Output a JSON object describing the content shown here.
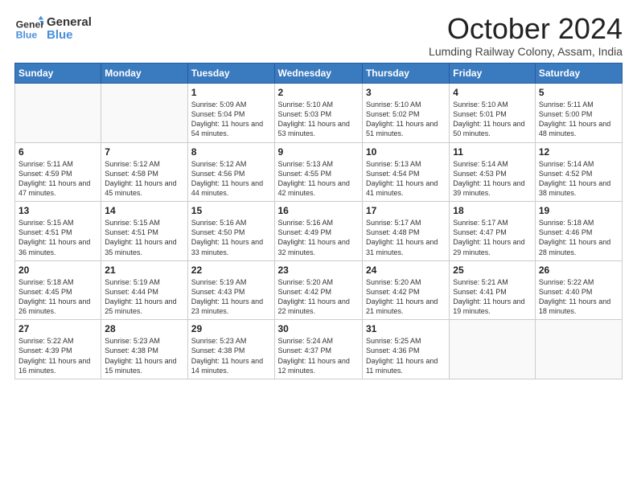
{
  "header": {
    "logo_line1": "General",
    "logo_line2": "Blue",
    "month_title": "October 2024",
    "location": "Lumding Railway Colony, Assam, India"
  },
  "days_of_week": [
    "Sunday",
    "Monday",
    "Tuesday",
    "Wednesday",
    "Thursday",
    "Friday",
    "Saturday"
  ],
  "weeks": [
    [
      {
        "day": "",
        "info": ""
      },
      {
        "day": "",
        "info": ""
      },
      {
        "day": "1",
        "info": "Sunrise: 5:09 AM\nSunset: 5:04 PM\nDaylight: 11 hours and 54 minutes."
      },
      {
        "day": "2",
        "info": "Sunrise: 5:10 AM\nSunset: 5:03 PM\nDaylight: 11 hours and 53 minutes."
      },
      {
        "day": "3",
        "info": "Sunrise: 5:10 AM\nSunset: 5:02 PM\nDaylight: 11 hours and 51 minutes."
      },
      {
        "day": "4",
        "info": "Sunrise: 5:10 AM\nSunset: 5:01 PM\nDaylight: 11 hours and 50 minutes."
      },
      {
        "day": "5",
        "info": "Sunrise: 5:11 AM\nSunset: 5:00 PM\nDaylight: 11 hours and 48 minutes."
      }
    ],
    [
      {
        "day": "6",
        "info": "Sunrise: 5:11 AM\nSunset: 4:59 PM\nDaylight: 11 hours and 47 minutes."
      },
      {
        "day": "7",
        "info": "Sunrise: 5:12 AM\nSunset: 4:58 PM\nDaylight: 11 hours and 45 minutes."
      },
      {
        "day": "8",
        "info": "Sunrise: 5:12 AM\nSunset: 4:56 PM\nDaylight: 11 hours and 44 minutes."
      },
      {
        "day": "9",
        "info": "Sunrise: 5:13 AM\nSunset: 4:55 PM\nDaylight: 11 hours and 42 minutes."
      },
      {
        "day": "10",
        "info": "Sunrise: 5:13 AM\nSunset: 4:54 PM\nDaylight: 11 hours and 41 minutes."
      },
      {
        "day": "11",
        "info": "Sunrise: 5:14 AM\nSunset: 4:53 PM\nDaylight: 11 hours and 39 minutes."
      },
      {
        "day": "12",
        "info": "Sunrise: 5:14 AM\nSunset: 4:52 PM\nDaylight: 11 hours and 38 minutes."
      }
    ],
    [
      {
        "day": "13",
        "info": "Sunrise: 5:15 AM\nSunset: 4:51 PM\nDaylight: 11 hours and 36 minutes."
      },
      {
        "day": "14",
        "info": "Sunrise: 5:15 AM\nSunset: 4:51 PM\nDaylight: 11 hours and 35 minutes."
      },
      {
        "day": "15",
        "info": "Sunrise: 5:16 AM\nSunset: 4:50 PM\nDaylight: 11 hours and 33 minutes."
      },
      {
        "day": "16",
        "info": "Sunrise: 5:16 AM\nSunset: 4:49 PM\nDaylight: 11 hours and 32 minutes."
      },
      {
        "day": "17",
        "info": "Sunrise: 5:17 AM\nSunset: 4:48 PM\nDaylight: 11 hours and 31 minutes."
      },
      {
        "day": "18",
        "info": "Sunrise: 5:17 AM\nSunset: 4:47 PM\nDaylight: 11 hours and 29 minutes."
      },
      {
        "day": "19",
        "info": "Sunrise: 5:18 AM\nSunset: 4:46 PM\nDaylight: 11 hours and 28 minutes."
      }
    ],
    [
      {
        "day": "20",
        "info": "Sunrise: 5:18 AM\nSunset: 4:45 PM\nDaylight: 11 hours and 26 minutes."
      },
      {
        "day": "21",
        "info": "Sunrise: 5:19 AM\nSunset: 4:44 PM\nDaylight: 11 hours and 25 minutes."
      },
      {
        "day": "22",
        "info": "Sunrise: 5:19 AM\nSunset: 4:43 PM\nDaylight: 11 hours and 23 minutes."
      },
      {
        "day": "23",
        "info": "Sunrise: 5:20 AM\nSunset: 4:42 PM\nDaylight: 11 hours and 22 minutes."
      },
      {
        "day": "24",
        "info": "Sunrise: 5:20 AM\nSunset: 4:42 PM\nDaylight: 11 hours and 21 minutes."
      },
      {
        "day": "25",
        "info": "Sunrise: 5:21 AM\nSunset: 4:41 PM\nDaylight: 11 hours and 19 minutes."
      },
      {
        "day": "26",
        "info": "Sunrise: 5:22 AM\nSunset: 4:40 PM\nDaylight: 11 hours and 18 minutes."
      }
    ],
    [
      {
        "day": "27",
        "info": "Sunrise: 5:22 AM\nSunset: 4:39 PM\nDaylight: 11 hours and 16 minutes."
      },
      {
        "day": "28",
        "info": "Sunrise: 5:23 AM\nSunset: 4:38 PM\nDaylight: 11 hours and 15 minutes."
      },
      {
        "day": "29",
        "info": "Sunrise: 5:23 AM\nSunset: 4:38 PM\nDaylight: 11 hours and 14 minutes."
      },
      {
        "day": "30",
        "info": "Sunrise: 5:24 AM\nSunset: 4:37 PM\nDaylight: 11 hours and 12 minutes."
      },
      {
        "day": "31",
        "info": "Sunrise: 5:25 AM\nSunset: 4:36 PM\nDaylight: 11 hours and 11 minutes."
      },
      {
        "day": "",
        "info": ""
      },
      {
        "day": "",
        "info": ""
      }
    ]
  ]
}
